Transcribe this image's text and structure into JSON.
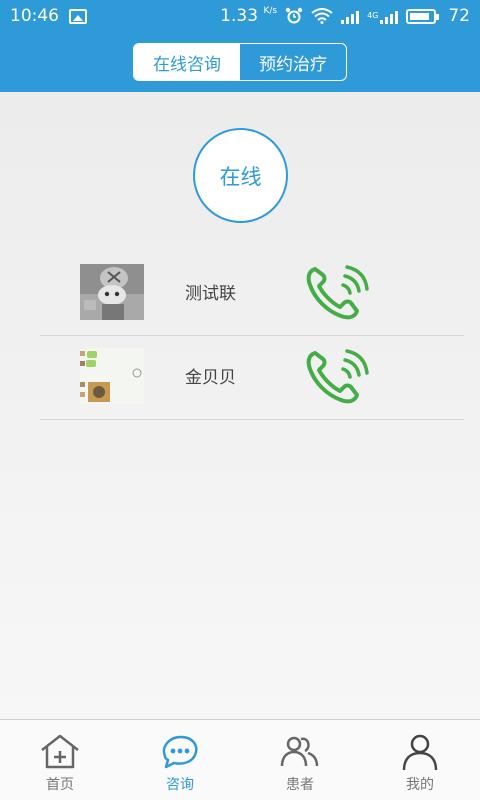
{
  "status_bar": {
    "time": "10:46",
    "speed": "1.33",
    "speed_unit": "K/s",
    "network": "4G",
    "battery": "72",
    "icons": [
      "image-icon",
      "alarm-icon",
      "wifi-icon",
      "signal-icon",
      "battery-icon"
    ]
  },
  "header": {
    "tabs": [
      {
        "label": "在线咨询",
        "active": true
      },
      {
        "label": "预约治疗",
        "active": false
      }
    ]
  },
  "main": {
    "status_label": "在线",
    "contacts": [
      {
        "name": "测试联",
        "avatar_icon": "cartoon-avatar",
        "action_icon": "phone-call-icon"
      },
      {
        "name": "金贝贝",
        "avatar_icon": "chat-thumbnail-avatar",
        "action_icon": "phone-call-icon"
      }
    ]
  },
  "tabbar": {
    "items": [
      {
        "label": "首页",
        "icon": "home-icon",
        "active": false
      },
      {
        "label": "咨询",
        "icon": "chat-bubble-icon",
        "active": true
      },
      {
        "label": "患者",
        "icon": "patients-icon",
        "active": false
      },
      {
        "label": "我的",
        "icon": "user-icon",
        "active": false
      }
    ]
  },
  "colors": {
    "primary": "#2f9ad8",
    "call_green": "#45ad45",
    "inactive_gray": "#777777"
  }
}
